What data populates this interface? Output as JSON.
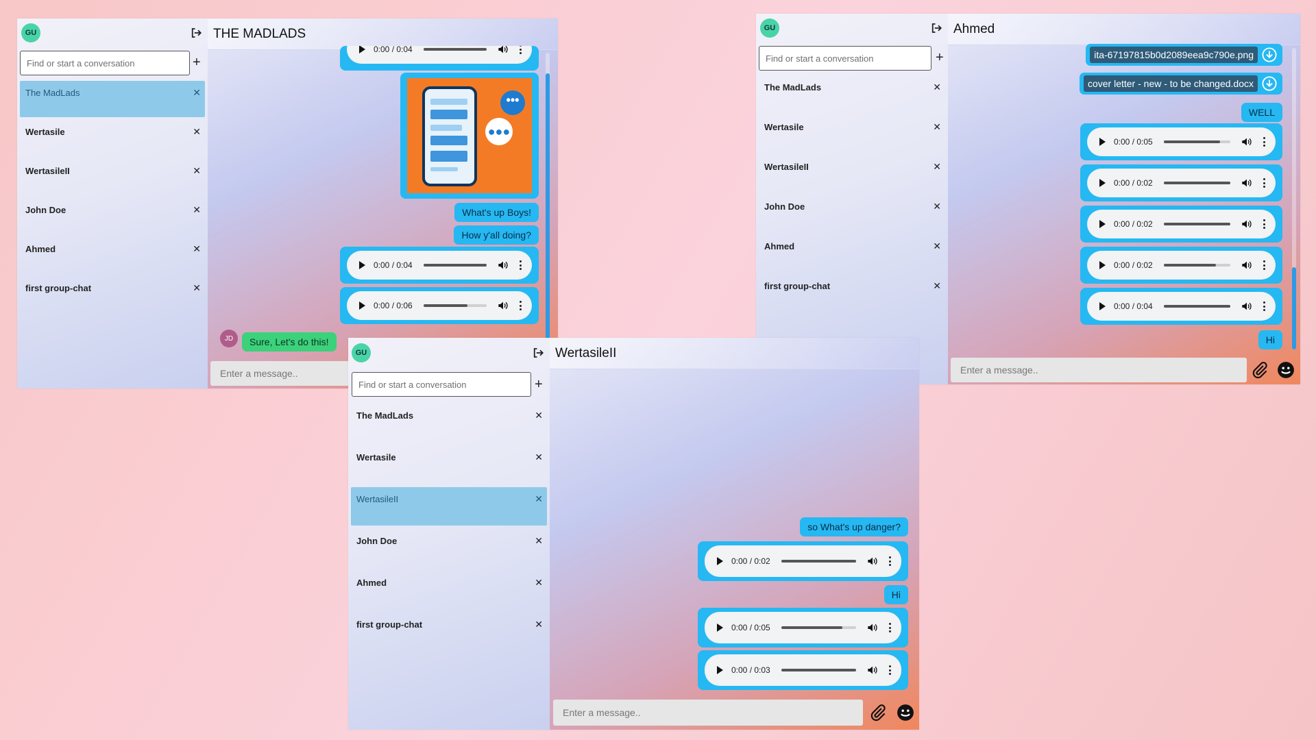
{
  "app": {
    "avatar_initials": "GU",
    "search_placeholder": "Find or start a conversation",
    "message_placeholder": "Enter a message..",
    "accent": "#26b8f2",
    "active_item_color": "#8ec9ea"
  },
  "conversations": [
    {
      "label": "The MadLads",
      "close": "✕"
    },
    {
      "label": "Wertasile",
      "close": "✕"
    },
    {
      "label": "WertasileII",
      "close": "✕"
    },
    {
      "label": "John Doe",
      "close": "✕"
    },
    {
      "label": "Ahmed",
      "close": "✕"
    },
    {
      "label": "first group-chat",
      "close": "✕"
    }
  ],
  "window1": {
    "title": "THE MADLADS",
    "active_conversation": "The MadLads",
    "messages": [
      {
        "type": "audio",
        "time": "0:00 / 0:04",
        "progress": 1.0
      },
      {
        "type": "image",
        "description_icon": "chat-app-phone-illustration"
      },
      {
        "type": "text",
        "text": "What's up Boys!"
      },
      {
        "type": "text",
        "text": "How y'all doing?"
      },
      {
        "type": "audio",
        "time": "0:00 / 0:04",
        "progress": 1.0
      },
      {
        "type": "audio",
        "time": "0:00 / 0:06",
        "progress": 0.7
      },
      {
        "type": "text",
        "sender": "JD",
        "text": "Sure, Let's do this!"
      }
    ]
  },
  "window2": {
    "title": "Ahmed",
    "active_conversation": "Ahmed",
    "messages": [
      {
        "type": "file",
        "name": "ita-67197815b0d2089eea9c790e.png"
      },
      {
        "type": "file",
        "name": "cover letter - new - to be changed.docx"
      },
      {
        "type": "text",
        "text": "WELL"
      },
      {
        "type": "audio",
        "time": "0:00 / 0:05",
        "progress": 0.85
      },
      {
        "type": "audio",
        "time": "0:00 / 0:02",
        "progress": 1.0
      },
      {
        "type": "audio",
        "time": "0:00 / 0:02",
        "progress": 1.0
      },
      {
        "type": "audio",
        "time": "0:00 / 0:02",
        "progress": 0.78
      },
      {
        "type": "audio",
        "time": "0:00 / 0:04",
        "progress": 1.0
      },
      {
        "type": "text",
        "text": "Hi"
      }
    ]
  },
  "window3": {
    "title": "WertasileII",
    "active_conversation": "WertasileII",
    "messages": [
      {
        "type": "text",
        "text": "so What's up danger?"
      },
      {
        "type": "audio",
        "time": "0:00 / 0:02",
        "progress": 1.0
      },
      {
        "type": "text",
        "text": "Hi"
      },
      {
        "type": "audio",
        "time": "0:00 / 0:05",
        "progress": 0.82
      },
      {
        "type": "audio",
        "time": "0:00 / 0:03",
        "progress": 1.0
      }
    ]
  }
}
